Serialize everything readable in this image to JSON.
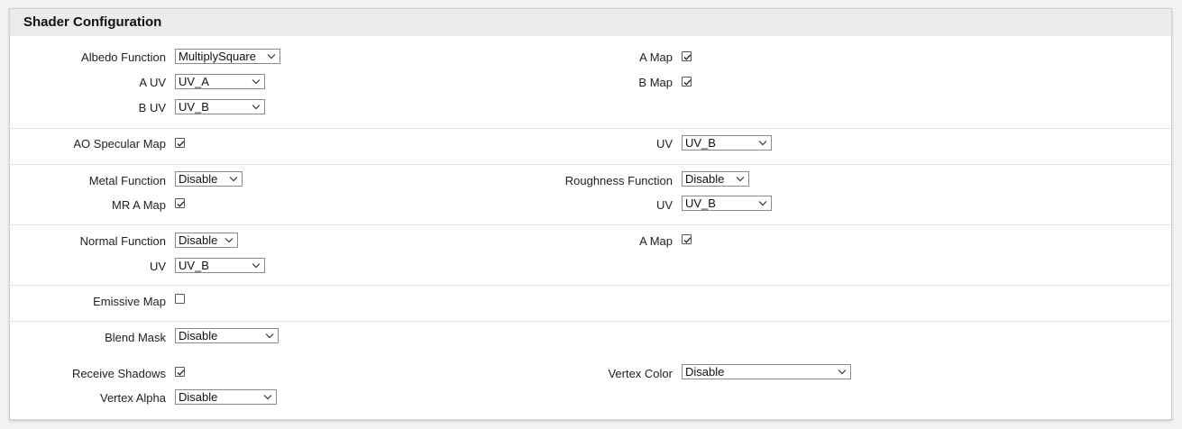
{
  "panel": {
    "title": "Shader Configuration"
  },
  "albedo": {
    "function_label": "Albedo Function",
    "function_value": "MultiplySquare",
    "a_uv_label": "A UV",
    "a_uv_value": "UV_A",
    "b_uv_label": "B UV",
    "b_uv_value": "UV_B",
    "a_map_label": "A Map",
    "a_map_checked": true,
    "b_map_label": "B Map",
    "b_map_checked": true
  },
  "ao": {
    "map_label": "AO Specular Map",
    "map_checked": true,
    "uv_label": "UV",
    "uv_value": "UV_B"
  },
  "metal": {
    "function_label": "Metal Function",
    "function_value": "Disable",
    "mr_a_map_label": "MR A Map",
    "mr_a_map_checked": true,
    "roughness_label": "Roughness Function",
    "roughness_value": "Disable",
    "uv_label": "UV",
    "uv_value": "UV_B"
  },
  "normal": {
    "function_label": "Normal Function",
    "function_value": "Disable",
    "uv_label": "UV",
    "uv_value": "UV_B",
    "a_map_label": "A Map",
    "a_map_checked": true
  },
  "emissive": {
    "map_label": "Emissive Map",
    "map_checked": false
  },
  "misc": {
    "blend_mask_label": "Blend Mask",
    "blend_mask_value": "Disable",
    "receive_shadows_label": "Receive Shadows",
    "receive_shadows_checked": true,
    "vertex_alpha_label": "Vertex Alpha",
    "vertex_alpha_value": "Disable",
    "vertex_color_label": "Vertex Color",
    "vertex_color_value": "Disable"
  },
  "icons": {
    "dropdown": "chevron-down-icon",
    "checkbox": "checkbox-icon"
  },
  "colors": {
    "header_bg": "#ebebeb",
    "border": "#cfcfcf",
    "separator": "#e2e2e2"
  }
}
